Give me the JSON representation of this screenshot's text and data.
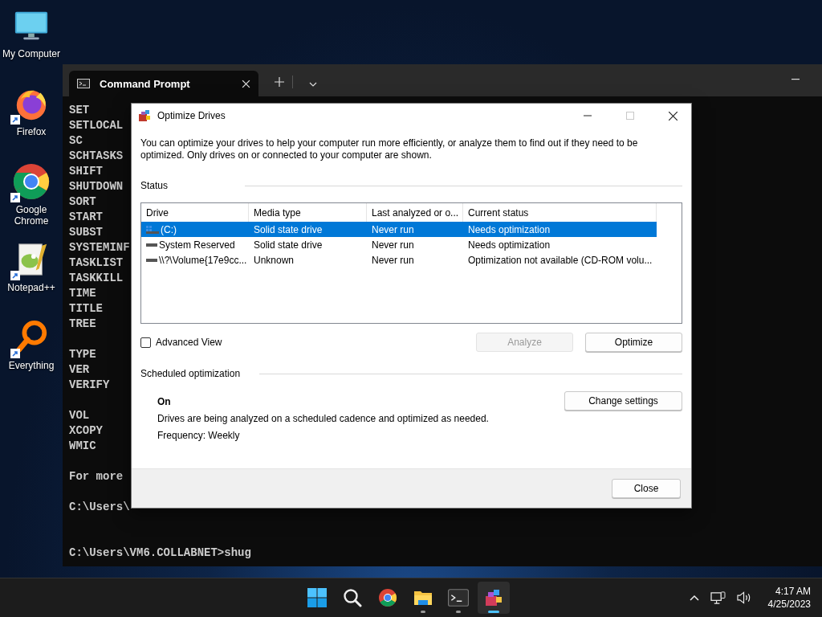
{
  "desktop_icons": [
    {
      "label": "My Computer",
      "kind": "computer",
      "shortcut": false
    },
    {
      "label": "Firefox",
      "kind": "firefox",
      "shortcut": true
    },
    {
      "label": "Google Chrome",
      "kind": "chrome",
      "shortcut": true
    },
    {
      "label": "Notepad++",
      "kind": "notepad",
      "shortcut": true
    },
    {
      "label": "Everything",
      "kind": "everything",
      "shortcut": true
    }
  ],
  "terminal": {
    "tabs": [
      {
        "label": "Command Prompt",
        "selected": true
      }
    ],
    "blocks": [
      [
        "SET",
        "SETLOCAL",
        "SC",
        "SCHTASKS",
        "SHIFT",
        "SHUTDOWN",
        "SORT",
        "START",
        "SUBST",
        "SYSTEMINF",
        "TASKLIST",
        "TASKKILL",
        "TIME",
        "TITLE",
        "TREE"
      ],
      [
        "TYPE",
        "VER",
        "VERIFY"
      ],
      [
        "VOL",
        "XCOPY",
        "WMIC"
      ],
      [
        "For more"
      ],
      [
        "C:\\Users\\"
      ],
      [
        "C:\\Users\\VM6.COLLABNET>shug"
      ]
    ]
  },
  "dialog": {
    "title": "Optimize Drives",
    "description": "You can optimize your drives to help your computer run more efficiently, or analyze them to find out if they need to be optimized. Only drives on or connected to your computer are shown.",
    "status_heading": "Status",
    "table": {
      "columns": [
        "Drive",
        "Media type",
        "Last analyzed or o...",
        "Current status"
      ],
      "rows": [
        {
          "kind": "system",
          "drive": "(C:)",
          "media_type": "Solid state drive",
          "last_analyzed": "Never run",
          "current_status": "Needs optimization",
          "selected": true
        },
        {
          "kind": "drive",
          "drive": "System Reserved",
          "media_type": "Solid state drive",
          "last_analyzed": "Never run",
          "current_status": "Needs optimization",
          "selected": false
        },
        {
          "kind": "drive",
          "drive": "\\\\?\\Volume{17e9cc...",
          "media_type": "Unknown",
          "last_analyzed": "Never run",
          "current_status": "Optimization not available (CD-ROM volu...",
          "selected": false
        }
      ]
    },
    "advanced_view": {
      "label": "Advanced View",
      "checked": false
    },
    "buttons": [
      {
        "label": "Analyze",
        "disabled": true
      },
      {
        "label": "Optimize",
        "disabled": false
      }
    ],
    "scheduled": {
      "heading": "Scheduled optimization",
      "state": "On",
      "description": "Drives are being analyzed on a scheduled cadence and optimized as needed.",
      "frequency": "Frequency: Weekly",
      "button": "Change settings"
    },
    "close_button": "Close"
  },
  "taskbar": {
    "apps": [
      {
        "kind": "start",
        "running": false,
        "selected": false
      },
      {
        "kind": "search",
        "running": false,
        "selected": false
      },
      {
        "kind": "chrome",
        "running": false,
        "selected": false
      },
      {
        "kind": "explorer",
        "running": true,
        "selected": false
      },
      {
        "kind": "terminal",
        "running": true,
        "selected": false
      },
      {
        "kind": "defrag",
        "running": true,
        "selected": true
      }
    ],
    "time": "4:17 AM",
    "date": "4/25/2023"
  }
}
